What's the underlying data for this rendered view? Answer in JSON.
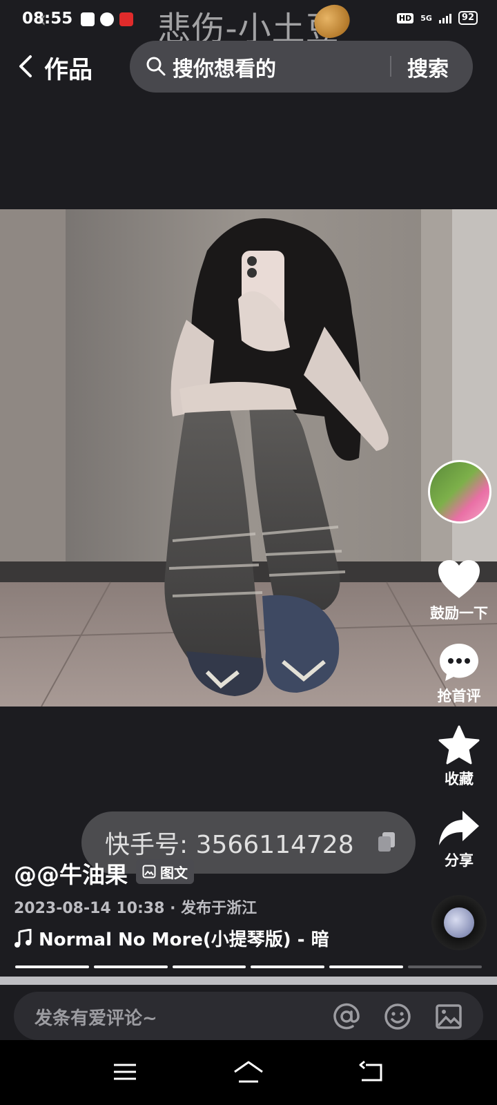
{
  "status_bar": {
    "time": "08:55",
    "network": "5G",
    "hd": "HD",
    "battery": "92"
  },
  "watermark": {
    "text": "悲伤-小土豆"
  },
  "nav": {
    "title": "作品",
    "search_placeholder": "搜你想看的",
    "search_button": "搜索"
  },
  "rail": {
    "like_label": "鼓励一下",
    "comment_label": "抢首评",
    "favorite_label": "收藏",
    "share_label": "分享"
  },
  "id_bubble": {
    "text": "快手号: 3566114728"
  },
  "post": {
    "username": "@@牛油果",
    "type_badge": "图文",
    "meta": "2023-08-14 10:38 · 发布于浙江",
    "music": "Normal No More(小提琴版) - 暗",
    "image_count": 6,
    "current_image": 5
  },
  "comment_bar": {
    "placeholder": "发条有爱评论~"
  }
}
